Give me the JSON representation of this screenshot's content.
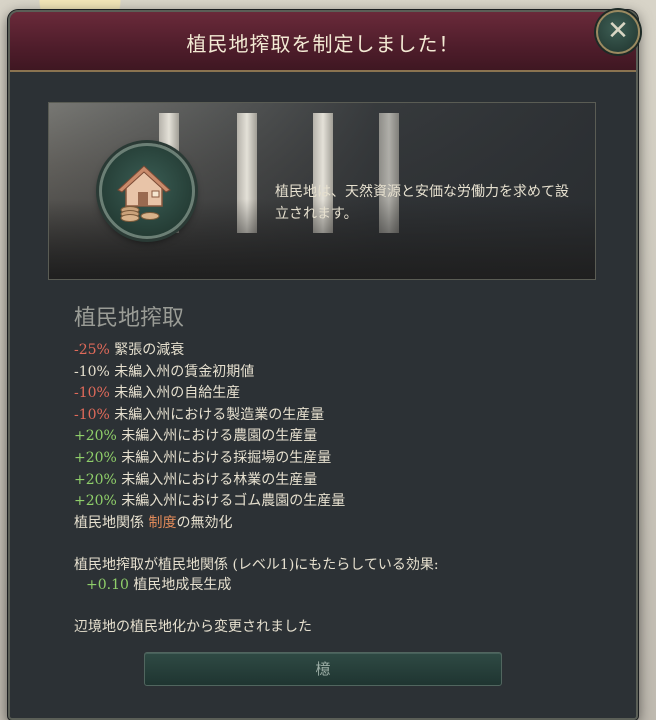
{
  "dialog": {
    "title": "植民地搾取を制定しました！",
    "close_icon": "close-icon",
    "banner": {
      "description": "植民地は、天然資源と安価な労働力を求めて設立されます。",
      "emblem_icon": "house-coins-icon"
    },
    "law_name": "植民地搾取",
    "effects": [
      {
        "value": "-25%",
        "text": " 緊張の減衰",
        "tone": "neg"
      },
      {
        "value": "-10%",
        "text": " 未編入州の賃金初期値",
        "tone": "neu"
      },
      {
        "value": "-10%",
        "text": " 未編入州の自給生産",
        "tone": "neg"
      },
      {
        "value": "-10%",
        "text": " 未編入州における製造業の生産量",
        "tone": "neg"
      },
      {
        "value": "+20%",
        "text": " 未編入州における農園の生産量",
        "tone": "pos"
      },
      {
        "value": "+20%",
        "text": " 未編入州における採掘場の生産量",
        "tone": "pos"
      },
      {
        "value": "+20%",
        "text": " 未編入州における林業の生産量",
        "tone": "pos"
      },
      {
        "value": "+20%",
        "text": " 未編入州におけるゴム農園の生産量",
        "tone": "pos"
      }
    ],
    "relation": {
      "a": "植民地関係",
      "b": "制度",
      "c": "の無効化"
    },
    "level_effect_intro": "植民地搾取が植民地関係 (レベル1)にもたらしている効果:",
    "level_effect_value": "+0.10",
    "level_effect_text": " 植民地成長生成",
    "changed_from": "辺境地の植民地化から変更されました",
    "ok_label": "檍"
  }
}
